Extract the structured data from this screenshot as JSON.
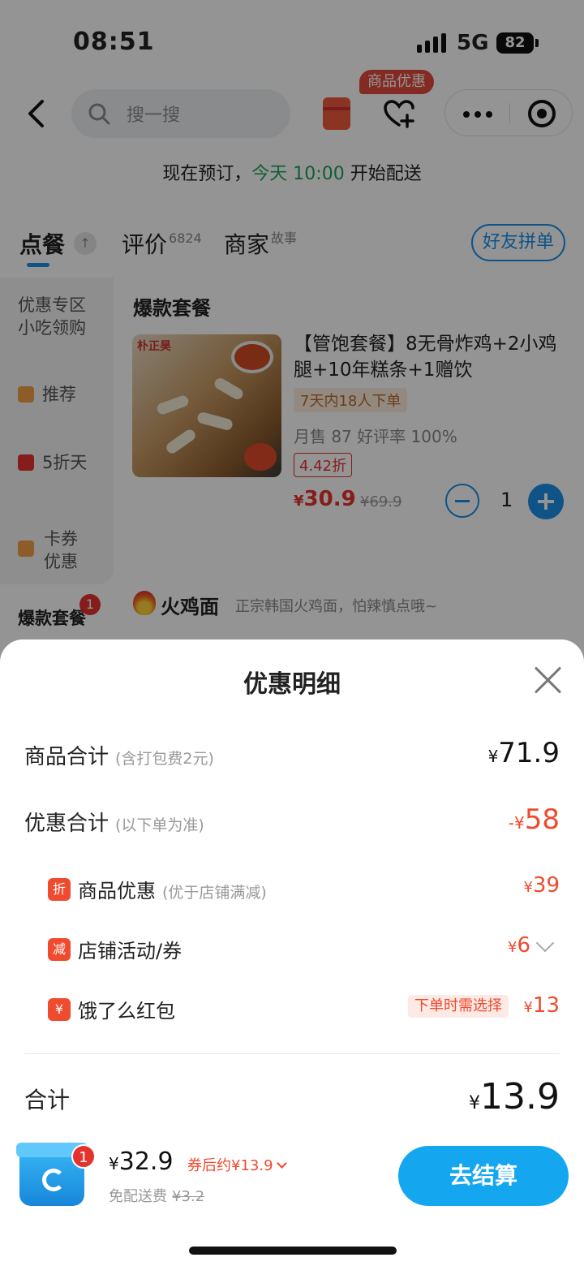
{
  "status_bar": {
    "time": "08:51",
    "network": "5G",
    "battery": "82"
  },
  "nav": {
    "search_placeholder": "搜一搜",
    "promo_badge": "商品优惠"
  },
  "notice": {
    "prefix": "现在预订，",
    "highlight": "今天 10:00",
    "suffix": " 开始配送"
  },
  "tabs": {
    "order": "点餐",
    "reviews": "评价",
    "reviews_count": "6824",
    "merchant": "商家",
    "merchant_sup": "故事",
    "friend_button": "好友拼单"
  },
  "sidebar": {
    "items": [
      {
        "label": "优惠专区\n小吃领购"
      },
      {
        "label": "推荐"
      },
      {
        "label": "5折天"
      },
      {
        "label": "卡券\n优惠"
      }
    ],
    "active_label": "爆款套餐",
    "active_badge": "1"
  },
  "product": {
    "section_title": "爆款套餐",
    "image_brand": "朴正昊",
    "name": "【管饱套餐】8无骨炸鸡+2小鸡腿+10年糕条+1赠饮",
    "orders_tag": "7天内18人下单",
    "sales": "月售 87  好评率 100%",
    "discount": "4.42折",
    "price_symbol": "¥",
    "price": "30.9",
    "original_price": "¥69.9",
    "quantity": "1"
  },
  "section2": {
    "title": "火鸡面",
    "desc": "正宗韩国火鸡面，怕辣慎点哦~"
  },
  "sheet": {
    "title": "优惠明细",
    "goods_total_label": "商品合计",
    "goods_total_note": "(含打包费2元)",
    "goods_total_value": "71.9",
    "discount_total_label": "优惠合计",
    "discount_total_note": "(以下单为准)",
    "discount_total_value": "58",
    "discount_prefix": "-¥",
    "items": [
      {
        "icon_text": "折",
        "label": "商品优惠",
        "note": "(优于店铺满减)",
        "value": "39"
      },
      {
        "icon_text": "减",
        "label": "店铺活动/券",
        "note": "",
        "value": "6"
      },
      {
        "icon_text": "¥",
        "label": "饿了么红包",
        "note": "",
        "value": "13",
        "tag": "下单时需选择"
      }
    ],
    "total_label": "合计",
    "total_value": "13.9",
    "yen": "¥"
  },
  "cart": {
    "badge": "1",
    "price": "32.9",
    "after_coupon": "券后约¥13.9",
    "free_delivery": "免配送费",
    "delivery_original": "¥3.2",
    "checkout": "去结算"
  },
  "colors": {
    "accent_blue": "#1a8fe8",
    "discount_red": "#ef4a2c",
    "checkout_blue": "#14a7f0"
  }
}
